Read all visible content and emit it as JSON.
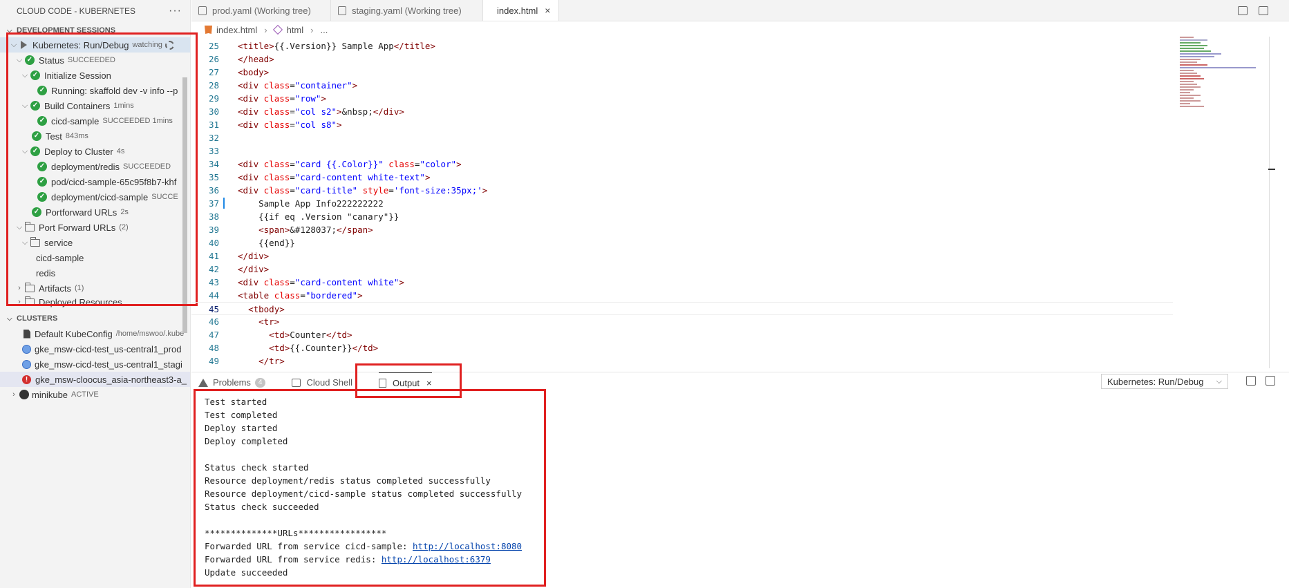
{
  "sidebar": {
    "title": "CLOUD CODE - KUBERNETES",
    "more": "···",
    "dev_sessions_title": "DEVELOPMENT SESSIONS",
    "session": {
      "label": "Kubernetes: Run/Debug",
      "desc": "watching"
    },
    "status": {
      "label": "Status",
      "desc": "SUCCEEDED"
    },
    "init": {
      "label": "Initialize Session"
    },
    "running": {
      "label": "Running: skaffold dev -v info --p"
    },
    "build": {
      "label": "Build Containers",
      "desc": "1mins"
    },
    "cicd": {
      "label": "cicd-sample",
      "desc": "SUCCEEDED 1mins"
    },
    "test": {
      "label": "Test",
      "desc": "843ms"
    },
    "deploy": {
      "label": "Deploy to Cluster",
      "desc": "4s"
    },
    "dep_redis": {
      "label": "deployment/redis",
      "desc": "SUCCEEDED"
    },
    "pod": {
      "label": "pod/cicd-sample-65c95f8b7-khf"
    },
    "dep_cicd": {
      "label": "deployment/cicd-sample",
      "desc": "SUCCE"
    },
    "pf_urls": {
      "label": "Portforward URLs",
      "desc": "2s"
    },
    "port_forward": {
      "label": "Port Forward URLs",
      "desc": "(2)"
    },
    "service": {
      "label": "service"
    },
    "svc_cicd": {
      "label": "cicd-sample"
    },
    "svc_redis": {
      "label": "redis"
    },
    "artifacts": {
      "label": "Artifacts",
      "desc": "(1)"
    },
    "deployed": {
      "label": "Deployed Resources"
    },
    "clusters_title": "CLUSTERS",
    "clusters": [
      {
        "label": "Default KubeConfig",
        "desc": "/home/mswoo/.kube"
      },
      {
        "label": "gke_msw-cicd-test_us-central1_prod"
      },
      {
        "label": "gke_msw-cicd-test_us-central1_stagi"
      },
      {
        "label": "gke_msw-cloocus_asia-northeast3-a_"
      },
      {
        "label": "minikube",
        "desc": "ACTIVE"
      }
    ]
  },
  "tabs": [
    {
      "label": "prod.yaml (Working tree)"
    },
    {
      "label": "staging.yaml (Working tree)"
    },
    {
      "label": "index.html",
      "close": "×"
    }
  ],
  "breadcrumb": {
    "file": "index.html",
    "node": "html",
    "more": "..."
  },
  "code": {
    "lines": [
      {
        "n": "25",
        "segs": [
          [
            "t",
            "<title>"
          ],
          [
            "p",
            "{{.Version}} Sample App"
          ],
          [
            "t",
            "</title>"
          ]
        ]
      },
      {
        "n": "26",
        "segs": [
          [
            "t",
            "</head>"
          ]
        ]
      },
      {
        "n": "27",
        "segs": [
          [
            "t",
            "<body>"
          ]
        ]
      },
      {
        "n": "28",
        "segs": [
          [
            "t",
            "<div "
          ],
          [
            "a",
            "class"
          ],
          [
            "p",
            "="
          ],
          [
            "s",
            "\"container\""
          ],
          [
            "t",
            ">"
          ]
        ]
      },
      {
        "n": "29",
        "segs": [
          [
            "t",
            "<div "
          ],
          [
            "a",
            "class"
          ],
          [
            "p",
            "="
          ],
          [
            "s",
            "\"row\""
          ],
          [
            "t",
            ">"
          ]
        ]
      },
      {
        "n": "30",
        "segs": [
          [
            "t",
            "<div "
          ],
          [
            "a",
            "class"
          ],
          [
            "p",
            "="
          ],
          [
            "s",
            "\"col s2\""
          ],
          [
            "t",
            ">"
          ],
          [
            "p",
            "&nbsp;"
          ],
          [
            "t",
            "</div>"
          ]
        ]
      },
      {
        "n": "31",
        "segs": [
          [
            "t",
            "<div "
          ],
          [
            "a",
            "class"
          ],
          [
            "p",
            "="
          ],
          [
            "s",
            "\"col s8\""
          ],
          [
            "t",
            ">"
          ]
        ]
      },
      {
        "n": "32",
        "segs": []
      },
      {
        "n": "33",
        "segs": []
      },
      {
        "n": "34",
        "segs": [
          [
            "t",
            "<div "
          ],
          [
            "a",
            "class"
          ],
          [
            "p",
            "="
          ],
          [
            "s",
            "\"card {{.Color}}\""
          ],
          [
            "p",
            " "
          ],
          [
            "a",
            "class"
          ],
          [
            "p",
            "="
          ],
          [
            "s",
            "\"color\""
          ],
          [
            "t",
            ">"
          ]
        ]
      },
      {
        "n": "35",
        "segs": [
          [
            "t",
            "<div "
          ],
          [
            "a",
            "class"
          ],
          [
            "p",
            "="
          ],
          [
            "s",
            "\"card-content white-text\""
          ],
          [
            "t",
            ">"
          ]
        ]
      },
      {
        "n": "36",
        "segs": [
          [
            "t",
            "<div "
          ],
          [
            "a",
            "class"
          ],
          [
            "p",
            "="
          ],
          [
            "s",
            "\"card-title\""
          ],
          [
            "p",
            " "
          ],
          [
            "a",
            "style"
          ],
          [
            "p",
            "="
          ],
          [
            "s",
            "'font-size:35px;'"
          ],
          [
            "t",
            ">"
          ]
        ]
      },
      {
        "n": "37",
        "segs": [
          [
            "p",
            "    Sample App Info222222222"
          ]
        ]
      },
      {
        "n": "38",
        "segs": [
          [
            "p",
            "    {{if eq .Version \"canary\"}}"
          ]
        ]
      },
      {
        "n": "39",
        "segs": [
          [
            "p",
            "    "
          ],
          [
            "t",
            "<span>"
          ],
          [
            "p",
            "&#128037;"
          ],
          [
            "t",
            "</span>"
          ]
        ]
      },
      {
        "n": "40",
        "segs": [
          [
            "p",
            "    {{end}}"
          ]
        ]
      },
      {
        "n": "41",
        "segs": [
          [
            "t",
            "</div>"
          ]
        ]
      },
      {
        "n": "42",
        "segs": [
          [
            "t",
            "</div>"
          ]
        ]
      },
      {
        "n": "43",
        "segs": [
          [
            "t",
            "<div "
          ],
          [
            "a",
            "class"
          ],
          [
            "p",
            "="
          ],
          [
            "s",
            "\"card-content white\""
          ],
          [
            "t",
            ">"
          ]
        ]
      },
      {
        "n": "44",
        "segs": [
          [
            "t",
            "<table "
          ],
          [
            "a",
            "class"
          ],
          [
            "p",
            "="
          ],
          [
            "s",
            "\"bordered\""
          ],
          [
            "t",
            ">"
          ]
        ]
      },
      {
        "n": "45",
        "segs": [
          [
            "p",
            "  "
          ],
          [
            "t",
            "<tbody>"
          ]
        ]
      },
      {
        "n": "46",
        "segs": [
          [
            "p",
            "    "
          ],
          [
            "t",
            "<tr>"
          ]
        ]
      },
      {
        "n": "47",
        "segs": [
          [
            "p",
            "      "
          ],
          [
            "t",
            "<td>"
          ],
          [
            "p",
            "Counter"
          ],
          [
            "t",
            "</td>"
          ]
        ]
      },
      {
        "n": "48",
        "segs": [
          [
            "p",
            "      "
          ],
          [
            "t",
            "<td>"
          ],
          [
            "p",
            "{{.Counter}}"
          ],
          [
            "t",
            "</td>"
          ]
        ]
      },
      {
        "n": "49",
        "segs": [
          [
            "p",
            "    "
          ],
          [
            "t",
            "</tr>"
          ]
        ]
      }
    ]
  },
  "panel": {
    "tabs": [
      {
        "label": "Problems",
        "badge": "4"
      },
      {
        "label": "Cloud Shell"
      },
      {
        "label": "Output",
        "close": "×"
      }
    ],
    "channel": "Kubernetes: Run/Debug",
    "output": [
      {
        "text": "Test started"
      },
      {
        "text": "Test completed"
      },
      {
        "text": "Deploy started"
      },
      {
        "text": "Deploy completed"
      },
      {
        "text": ""
      },
      {
        "text": "Status check started"
      },
      {
        "text": "Resource deployment/redis status completed successfully"
      },
      {
        "text": "Resource deployment/cicd-sample status completed successfully"
      },
      {
        "text": "Status check succeeded"
      },
      {
        "text": ""
      },
      {
        "text": "**************URLs*****************"
      },
      {
        "text": "Forwarded URL from service cicd-sample: ",
        "link": "http://localhost:8080"
      },
      {
        "text": "Forwarded URL from service redis: ",
        "link": "http://localhost:6379"
      },
      {
        "text": "Update succeeded"
      }
    ]
  },
  "colors": {
    "highlight": "#e02020",
    "success": "#2ea043",
    "error": "#d32f2f"
  }
}
